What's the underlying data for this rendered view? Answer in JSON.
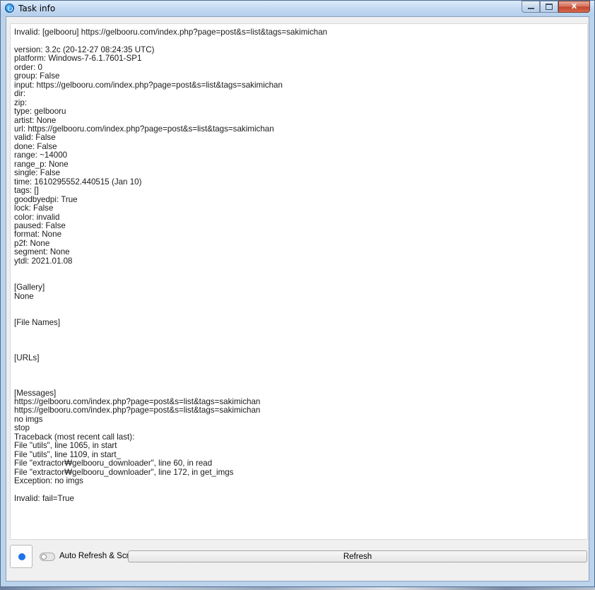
{
  "window": {
    "title": "Task info",
    "controls": {
      "minimize_icon": "minimize-icon",
      "maximize_icon": "maximize-icon",
      "close_label": "X"
    }
  },
  "log": {
    "lines": [
      "Invalid: [gelbooru] https://gelbooru.com/index.php?page=post&s=list&tags=sakimichan",
      "",
      "version: 3.2c (20-12-27 08:24:35 UTC)",
      "platform: Windows-7-6.1.7601-SP1",
      "order: 0",
      "group: False",
      "input: https://gelbooru.com/index.php?page=post&s=list&tags=sakimichan",
      "dir:",
      "zip:",
      "type: gelbooru",
      "artist: None",
      "url: https://gelbooru.com/index.php?page=post&s=list&tags=sakimichan",
      "valid: False",
      "done: False",
      "range: ~14000",
      "range_p: None",
      "single: False",
      "time: 1610295552.440515 (Jan 10)",
      "tags: []",
      "goodbyedpi: True",
      "lock: False",
      "color: invalid",
      "paused: False",
      "format: None",
      "p2f: None",
      "segment: None",
      "ytdl: 2021.01.08",
      "",
      "",
      "[Gallery]",
      "None",
      "",
      "",
      "[File Names]",
      "",
      "",
      "",
      "[URLs]",
      "",
      "",
      "",
      "[Messages]",
      "https://gelbooru.com/index.php?page=post&s=list&tags=sakimichan",
      "https://gelbooru.com/index.php?page=post&s=list&tags=sakimichan",
      "no imgs",
      "stop",
      "Traceback (most recent call last):",
      "File \"utils\", line 1065, in start",
      "File \"utils\", line 1109, in start_",
      "File \"extractor₩gelbooru_downloader\", line 60, in read",
      "File \"extractor₩gelbooru_downloader\", line 172, in get_imgs",
      "Exception: no imgs",
      "",
      "Invalid: fail=True"
    ]
  },
  "controls": {
    "record_button_color": "#1a73e8",
    "auto_refresh_label": "Auto Refresh & Scroll",
    "auto_refresh_on": false,
    "refresh_label": "Refresh"
  }
}
